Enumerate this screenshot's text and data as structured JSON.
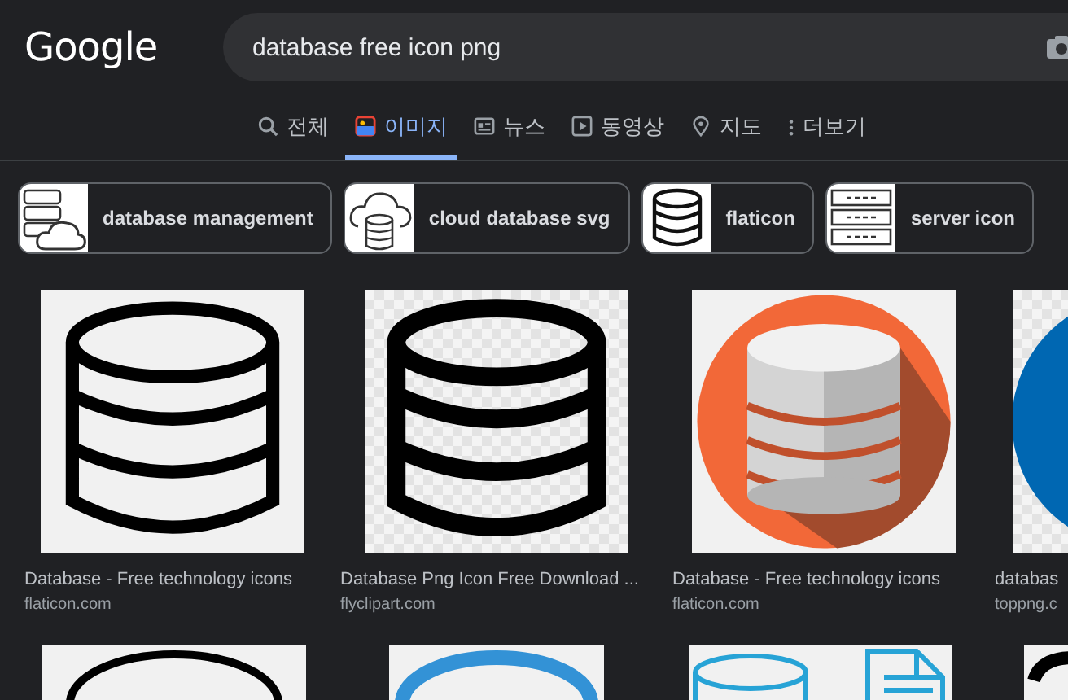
{
  "logo": "Google",
  "search": {
    "value": "database free icon png"
  },
  "tabs": [
    {
      "label": "전체",
      "selected": false
    },
    {
      "label": "이미지",
      "selected": true
    },
    {
      "label": "뉴스",
      "selected": false
    },
    {
      "label": "동영상",
      "selected": false
    },
    {
      "label": "지도",
      "selected": false
    },
    {
      "label": "더보기",
      "selected": false
    }
  ],
  "chips": [
    {
      "label": "database management"
    },
    {
      "label": "cloud database svg"
    },
    {
      "label": "flaticon"
    },
    {
      "label": "server icon"
    }
  ],
  "results": [
    {
      "title": "Database - Free technology icons",
      "source": "flaticon.com"
    },
    {
      "title": "Database Png Icon Free Download ...",
      "source": "flyclipart.com"
    },
    {
      "title": "Database - Free technology icons",
      "source": "flaticon.com"
    },
    {
      "title": "databas",
      "source": "toppng.c"
    }
  ]
}
